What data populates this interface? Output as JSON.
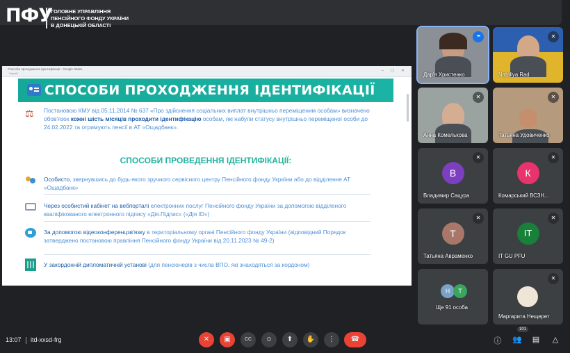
{
  "logo": {
    "mark": "ПФУ",
    "line1": "ГОЛОВНЕ УПРАВЛІННЯ",
    "line2": "ПЕНСІЙНОГО ФОНДУ УКРАЇНИ",
    "line3": "В ДОНЕЦЬКІЙ ОБЛАСТІ"
  },
  "browser": {
    "tab_title": "Способи проходження ідентифікації - Google Slides",
    "url": "Спосіб..."
  },
  "slide": {
    "title": "СПОСОБИ ПРОХОДЖЕННЯ ІДЕНТИФІКАЦІЇ",
    "intro_pre": "Постановою КМУ від 05.11.2014 № 637 «Про здійснення соціальних виплат внутрішньо переміщеним особам» визначено обов'язок ",
    "intro_bold": "кожні шість місяців проходити ідентифікацію",
    "intro_post": " особам, які набули статусу внутрішньо переміщеної особи до 24.02.2022 та отримують пенсії в АТ «Ощадбанк».",
    "subtitle": "СПОСОБИ ПРОВЕДЕННЯ ІДЕНТИФІКАЦІЇ:",
    "methods": [
      {
        "icon": "people-icon",
        "hl": "Особисто",
        "text": ", звернувшись до будь-якого зручного сервісного центру Пенсійного фонду України або до відділення АТ «Ощадбанк»"
      },
      {
        "icon": "monitor-icon",
        "hl": "Через особистий кабінет на вебпорталі",
        "text": " електронних послуг Пенсійного фонду України за допомогою відділеного кваліфікованого електронного підпису «Дія.Підпис» («Дія ID»)"
      },
      {
        "icon": "video-icon",
        "hl": "За допомогою відеоконференцзв'язку",
        "text": " в територіальному органі Пенсійного фонду України (відповідний Порядок затверджено постановою правління Пенсійного фонду України від 20.11.2023 № 49-2)"
      },
      {
        "icon": "embassy-icon",
        "hl": "У закордонній дипломатичній установі",
        "text": " (для пенсіонерів з числа ВПО, які знаходяться за кордоном)"
      }
    ]
  },
  "participants": [
    {
      "name": "Дар'я Христенко",
      "kind": "video",
      "mic": "speaking"
    },
    {
      "name": "Nataliya Rad",
      "kind": "video",
      "mic": "muted"
    },
    {
      "name": "Анна Комелькова",
      "kind": "video",
      "mic": "muted"
    },
    {
      "name": "Татьяна Удовиченко",
      "kind": "video",
      "mic": "muted"
    },
    {
      "name": "Владимир Сацура",
      "kind": "avatar",
      "initial": "В",
      "color": "#7b3fbf",
      "mic": "muted"
    },
    {
      "name": "Комарський ВСЗН...",
      "kind": "avatar",
      "initial": "К",
      "color": "#e8336d",
      "mic": "muted"
    },
    {
      "name": "Татьяна Авраменко",
      "kind": "avatar",
      "initial": "Т",
      "color": "#a9776a",
      "mic": "muted"
    },
    {
      "name": "IT GU PFU",
      "kind": "avatar",
      "initial": "IT",
      "color": "#188038",
      "mic": "muted"
    },
    {
      "name": "Ще 91 особа",
      "kind": "group",
      "initials": [
        "Н",
        "Т"
      ],
      "colors": [
        "#7aa1c8",
        "#3aa55c"
      ]
    },
    {
      "name": "Маргарита Нещерет",
      "kind": "photo",
      "mic": "muted"
    }
  ],
  "bottom_bar": {
    "time": "13:07",
    "meeting_code": "itd-xxsd-frg",
    "participants_count": "101",
    "colors": {
      "danger": "#ea4335",
      "button": "#3c4043"
    }
  }
}
